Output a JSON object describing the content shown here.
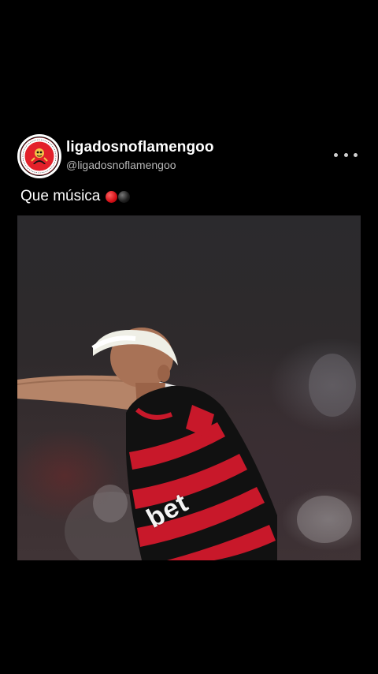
{
  "post": {
    "username": "ligadosnoflamengoo",
    "handle": "@ligadosnoflamengoo",
    "caption": "Que música",
    "caption_emojis": [
      "red-circle",
      "black-circle"
    ],
    "avatar_text": "LIGADOS NO FLAMENGO"
  },
  "media": {
    "jersey_sponsor": "bet"
  },
  "colors": {
    "background": "#000000",
    "username": "#ffffff",
    "handle": "#b7b7b7",
    "flamengo_red": "#d11a26",
    "flamengo_black": "#111111"
  }
}
